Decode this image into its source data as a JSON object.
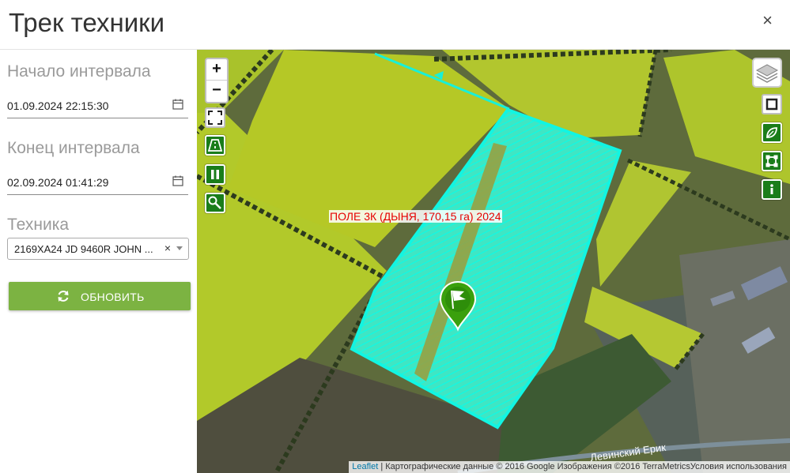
{
  "header": {
    "title": "Трек техники",
    "close_label": "×"
  },
  "sidebar": {
    "start": {
      "label": "Начало интервала",
      "value": "01.09.2024 22:15:30"
    },
    "end": {
      "label": "Конец интервала",
      "value": "02.09.2024 01:41:29"
    },
    "vehicle": {
      "label": "Техника",
      "value": "2169XA24 JD 9460R JOHN ...",
      "clear": "×"
    },
    "refresh_button": "ОБНОВИТЬ"
  },
  "map": {
    "zoom_in": "+",
    "zoom_out": "−",
    "field_label": "ПОЛЕ 3К (ДЫНЯ, 170,15 га) 2024",
    "road_label": "Левинский Ерик",
    "attribution": {
      "leaflet": "Leaflet",
      "text": " | Картографические данные © 2016 Google Изображения ©2016 TerraMetricsУсловия использования"
    },
    "colors": {
      "field_fill": "#b5c829",
      "track": "#18f0d8",
      "marker": "#3aa00d",
      "control_green": "#1a7d1a",
      "button": "#7cb342"
    }
  }
}
